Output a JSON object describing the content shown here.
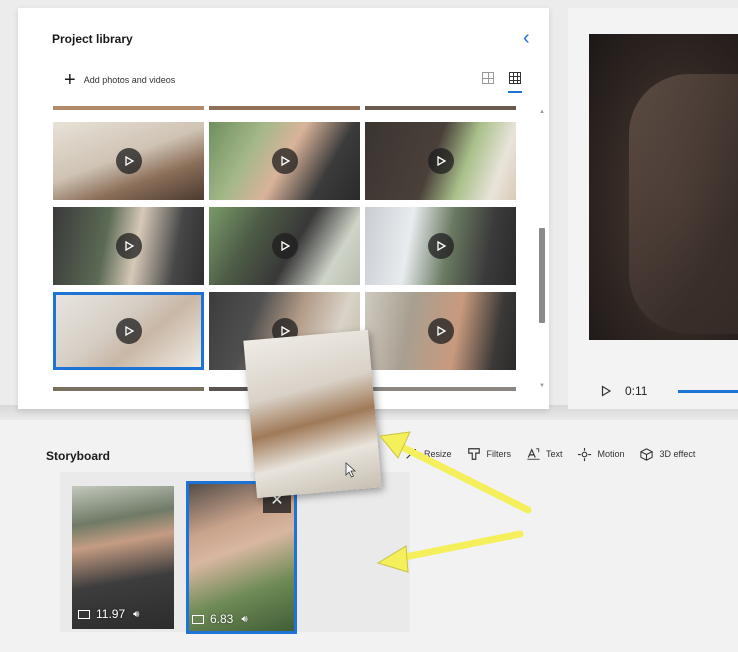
{
  "library": {
    "title": "Project library",
    "add_label": "Add photos and videos",
    "collapse_icon": "chevron-left-icon",
    "view_small_icon": "grid-small-icon",
    "view_large_icon": "grid-large-icon"
  },
  "preview": {
    "time": "0:11"
  },
  "storyboard": {
    "title": "Storyboard",
    "tools": [
      {
        "label": "Resize",
        "icon": "resize-icon"
      },
      {
        "label": "Filters",
        "icon": "filters-icon"
      },
      {
        "label": "Text",
        "icon": "text-icon"
      },
      {
        "label": "Motion",
        "icon": "motion-icon"
      },
      {
        "label": "3D effect",
        "icon": "3d-effects-icon"
      }
    ],
    "clips": [
      {
        "duration": "11.97"
      },
      {
        "duration": "6.83"
      }
    ]
  },
  "colors": {
    "accent": "#1e74d6",
    "annotation_arrow": "#f4ef5a"
  }
}
